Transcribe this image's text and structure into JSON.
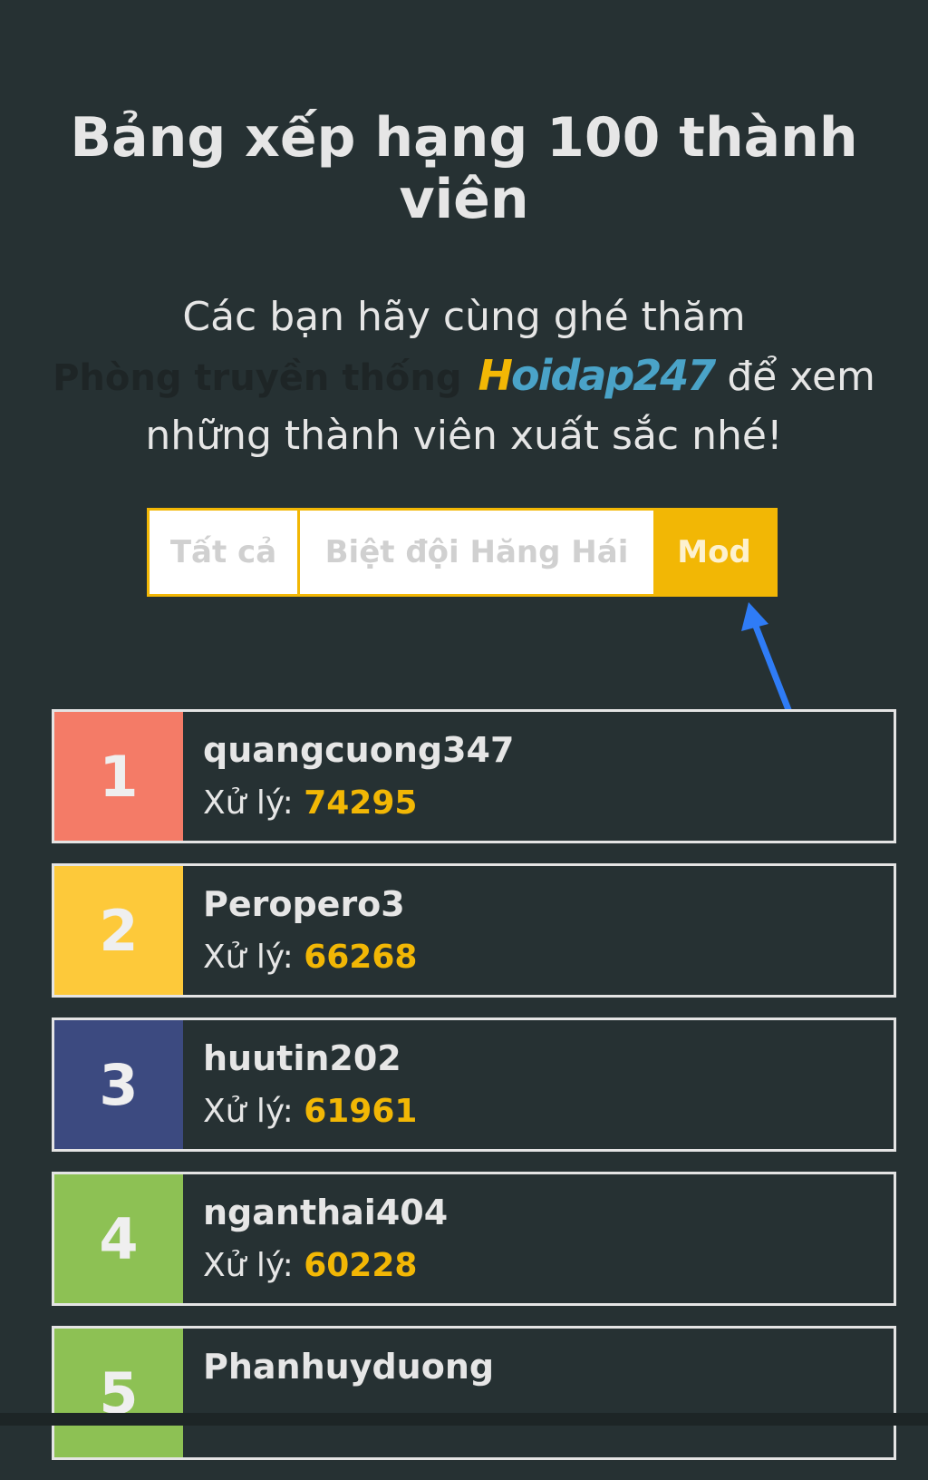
{
  "header": {
    "title": "Bảng xếp hạng 100 thành viên"
  },
  "intro": {
    "line1": "Các bạn hãy cùng ghé thăm",
    "hall_link": "Phòng truyền thống",
    "logo_h": "H",
    "logo_rest": "oidap247",
    "line2_suffix": "để xem",
    "line3": "những thành viên xuất sắc nhé!"
  },
  "tabs": [
    {
      "label": "Tất cả"
    },
    {
      "label": "Biệt đội Hăng Hái"
    },
    {
      "label": "Mod"
    }
  ],
  "active_tab": "Mod",
  "colors": {
    "background": "#263133",
    "accent": "#f2b705",
    "arrow": "#2f7cf6",
    "rank1": "#f47b67",
    "rank2": "#fdc93a",
    "rank3": "#3c4a80",
    "rank4": "#8dc154",
    "rank5": "#8dc154"
  },
  "ranking": {
    "score_label": "Xử lý:",
    "items": [
      {
        "rank": "1",
        "name": "quangcuong347",
        "score": "74295"
      },
      {
        "rank": "2",
        "name": "Peropero3",
        "score": "66268"
      },
      {
        "rank": "3",
        "name": "huutin202",
        "score": "61961"
      },
      {
        "rank": "4",
        "name": "nganthai404",
        "score": "60228"
      },
      {
        "rank": "5",
        "name": "Phanhuyduong",
        "score": ""
      }
    ]
  }
}
